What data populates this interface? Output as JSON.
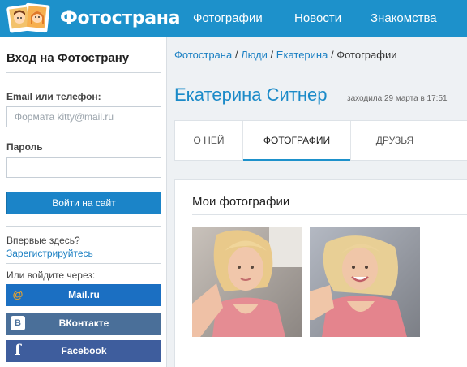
{
  "header": {
    "logo_text": "Фотострана",
    "nav": [
      "Фотографии",
      "Новости",
      "Знакомства"
    ]
  },
  "sidebar": {
    "login_title": "Вход на Фотострану",
    "email_label": "Email или телефон:",
    "email_placeholder": "Формата kitty@mail.ru",
    "password_label": "Пароль",
    "login_button": "Войти на сайт",
    "first_time_text": "Впервые здесь?",
    "register_link": "Зарегистрируйтесь",
    "or_login_text": "Или войдите через:",
    "social": [
      {
        "label": "Mail.ru",
        "icon": "at-icon",
        "color": "#1b6fc2"
      },
      {
        "label": "ВКонтакте",
        "icon": "vk-icon",
        "color": "#4a6f99"
      },
      {
        "label": "Facebook",
        "icon": "facebook-icon",
        "color": "#3e5d9d"
      }
    ]
  },
  "breadcrumb": {
    "items": [
      "Фотострана",
      "Люди",
      "Екатерина"
    ],
    "current": "Фотографии",
    "separator": "/"
  },
  "profile": {
    "name": "Екатерина Ситнер",
    "last_seen": "заходила 29 марта в 17:51"
  },
  "tabs": [
    "О НЕЙ",
    "ФОТОГРАФИИ",
    "ДРУЗЬЯ"
  ],
  "active_tab": "ФОТОГРАФИИ",
  "photos": {
    "title": "Мои фотографии",
    "count_shown": 2
  },
  "colors": {
    "header": "#1d91cb",
    "accent": "#1b8ac8",
    "link": "#1b80c3"
  }
}
